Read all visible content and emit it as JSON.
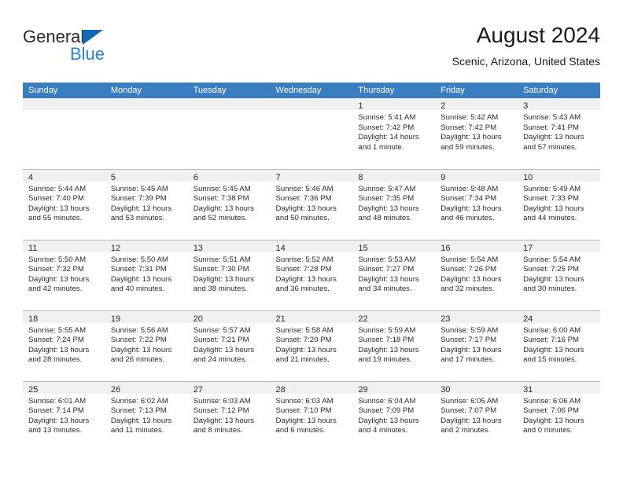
{
  "brand": {
    "name_part1": "General",
    "name_part2": "Blue",
    "flag_icon": "triangle-flag-icon"
  },
  "header": {
    "title": "August 2024",
    "subtitle": "Scenic, Arizona, United States"
  },
  "colors": {
    "header_blue": "#3a7dc0",
    "brand_blue": "#2585d4",
    "flag_blue": "#1268b3",
    "day_band_gray": "#f0f0f0",
    "grid_line": "#b9b9b9"
  },
  "calendar": {
    "weekday_headers": [
      "Sunday",
      "Monday",
      "Tuesday",
      "Wednesday",
      "Thursday",
      "Friday",
      "Saturday"
    ],
    "labels": {
      "sunrise": "Sunrise:",
      "sunset": "Sunset:",
      "daylight": "Daylight:"
    },
    "weeks": [
      [
        {
          "day": "",
          "empty": true
        },
        {
          "day": "",
          "empty": true
        },
        {
          "day": "",
          "empty": true
        },
        {
          "day": "",
          "empty": true
        },
        {
          "day": "1",
          "sunrise": "Sunrise: 5:41 AM",
          "sunset": "Sunset: 7:42 PM",
          "daylight_line1": "Daylight: 14 hours",
          "daylight_line2": "and 1 minute."
        },
        {
          "day": "2",
          "sunrise": "Sunrise: 5:42 AM",
          "sunset": "Sunset: 7:42 PM",
          "daylight_line1": "Daylight: 13 hours",
          "daylight_line2": "and 59 minutes."
        },
        {
          "day": "3",
          "sunrise": "Sunrise: 5:43 AM",
          "sunset": "Sunset: 7:41 PM",
          "daylight_line1": "Daylight: 13 hours",
          "daylight_line2": "and 57 minutes."
        }
      ],
      [
        {
          "day": "4",
          "sunrise": "Sunrise: 5:44 AM",
          "sunset": "Sunset: 7:40 PM",
          "daylight_line1": "Daylight: 13 hours",
          "daylight_line2": "and 55 minutes."
        },
        {
          "day": "5",
          "sunrise": "Sunrise: 5:45 AM",
          "sunset": "Sunset: 7:39 PM",
          "daylight_line1": "Daylight: 13 hours",
          "daylight_line2": "and 53 minutes."
        },
        {
          "day": "6",
          "sunrise": "Sunrise: 5:45 AM",
          "sunset": "Sunset: 7:38 PM",
          "daylight_line1": "Daylight: 13 hours",
          "daylight_line2": "and 52 minutes."
        },
        {
          "day": "7",
          "sunrise": "Sunrise: 5:46 AM",
          "sunset": "Sunset: 7:36 PM",
          "daylight_line1": "Daylight: 13 hours",
          "daylight_line2": "and 50 minutes."
        },
        {
          "day": "8",
          "sunrise": "Sunrise: 5:47 AM",
          "sunset": "Sunset: 7:35 PM",
          "daylight_line1": "Daylight: 13 hours",
          "daylight_line2": "and 48 minutes."
        },
        {
          "day": "9",
          "sunrise": "Sunrise: 5:48 AM",
          "sunset": "Sunset: 7:34 PM",
          "daylight_line1": "Daylight: 13 hours",
          "daylight_line2": "and 46 minutes."
        },
        {
          "day": "10",
          "sunrise": "Sunrise: 5:49 AM",
          "sunset": "Sunset: 7:33 PM",
          "daylight_line1": "Daylight: 13 hours",
          "daylight_line2": "and 44 minutes."
        }
      ],
      [
        {
          "day": "11",
          "sunrise": "Sunrise: 5:50 AM",
          "sunset": "Sunset: 7:32 PM",
          "daylight_line1": "Daylight: 13 hours",
          "daylight_line2": "and 42 minutes."
        },
        {
          "day": "12",
          "sunrise": "Sunrise: 5:50 AM",
          "sunset": "Sunset: 7:31 PM",
          "daylight_line1": "Daylight: 13 hours",
          "daylight_line2": "and 40 minutes."
        },
        {
          "day": "13",
          "sunrise": "Sunrise: 5:51 AM",
          "sunset": "Sunset: 7:30 PM",
          "daylight_line1": "Daylight: 13 hours",
          "daylight_line2": "and 38 minutes."
        },
        {
          "day": "14",
          "sunrise": "Sunrise: 5:52 AM",
          "sunset": "Sunset: 7:28 PM",
          "daylight_line1": "Daylight: 13 hours",
          "daylight_line2": "and 36 minutes."
        },
        {
          "day": "15",
          "sunrise": "Sunrise: 5:53 AM",
          "sunset": "Sunset: 7:27 PM",
          "daylight_line1": "Daylight: 13 hours",
          "daylight_line2": "and 34 minutes."
        },
        {
          "day": "16",
          "sunrise": "Sunrise: 5:54 AM",
          "sunset": "Sunset: 7:26 PM",
          "daylight_line1": "Daylight: 13 hours",
          "daylight_line2": "and 32 minutes."
        },
        {
          "day": "17",
          "sunrise": "Sunrise: 5:54 AM",
          "sunset": "Sunset: 7:25 PM",
          "daylight_line1": "Daylight: 13 hours",
          "daylight_line2": "and 30 minutes."
        }
      ],
      [
        {
          "day": "18",
          "sunrise": "Sunrise: 5:55 AM",
          "sunset": "Sunset: 7:24 PM",
          "daylight_line1": "Daylight: 13 hours",
          "daylight_line2": "and 28 minutes."
        },
        {
          "day": "19",
          "sunrise": "Sunrise: 5:56 AM",
          "sunset": "Sunset: 7:22 PM",
          "daylight_line1": "Daylight: 13 hours",
          "daylight_line2": "and 26 minutes."
        },
        {
          "day": "20",
          "sunrise": "Sunrise: 5:57 AM",
          "sunset": "Sunset: 7:21 PM",
          "daylight_line1": "Daylight: 13 hours",
          "daylight_line2": "and 24 minutes."
        },
        {
          "day": "21",
          "sunrise": "Sunrise: 5:58 AM",
          "sunset": "Sunset: 7:20 PM",
          "daylight_line1": "Daylight: 13 hours",
          "daylight_line2": "and 21 minutes."
        },
        {
          "day": "22",
          "sunrise": "Sunrise: 5:59 AM",
          "sunset": "Sunset: 7:18 PM",
          "daylight_line1": "Daylight: 13 hours",
          "daylight_line2": "and 19 minutes."
        },
        {
          "day": "23",
          "sunrise": "Sunrise: 5:59 AM",
          "sunset": "Sunset: 7:17 PM",
          "daylight_line1": "Daylight: 13 hours",
          "daylight_line2": "and 17 minutes."
        },
        {
          "day": "24",
          "sunrise": "Sunrise: 6:00 AM",
          "sunset": "Sunset: 7:16 PM",
          "daylight_line1": "Daylight: 13 hours",
          "daylight_line2": "and 15 minutes."
        }
      ],
      [
        {
          "day": "25",
          "sunrise": "Sunrise: 6:01 AM",
          "sunset": "Sunset: 7:14 PM",
          "daylight_line1": "Daylight: 13 hours",
          "daylight_line2": "and 13 minutes."
        },
        {
          "day": "26",
          "sunrise": "Sunrise: 6:02 AM",
          "sunset": "Sunset: 7:13 PM",
          "daylight_line1": "Daylight: 13 hours",
          "daylight_line2": "and 11 minutes."
        },
        {
          "day": "27",
          "sunrise": "Sunrise: 6:03 AM",
          "sunset": "Sunset: 7:12 PM",
          "daylight_line1": "Daylight: 13 hours",
          "daylight_line2": "and 8 minutes."
        },
        {
          "day": "28",
          "sunrise": "Sunrise: 6:03 AM",
          "sunset": "Sunset: 7:10 PM",
          "daylight_line1": "Daylight: 13 hours",
          "daylight_line2": "and 6 minutes."
        },
        {
          "day": "29",
          "sunrise": "Sunrise: 6:04 AM",
          "sunset": "Sunset: 7:09 PM",
          "daylight_line1": "Daylight: 13 hours",
          "daylight_line2": "and 4 minutes."
        },
        {
          "day": "30",
          "sunrise": "Sunrise: 6:05 AM",
          "sunset": "Sunset: 7:07 PM",
          "daylight_line1": "Daylight: 13 hours",
          "daylight_line2": "and 2 minutes."
        },
        {
          "day": "31",
          "sunrise": "Sunrise: 6:06 AM",
          "sunset": "Sunset: 7:06 PM",
          "daylight_line1": "Daylight: 13 hours",
          "daylight_line2": "and 0 minutes."
        }
      ]
    ]
  }
}
